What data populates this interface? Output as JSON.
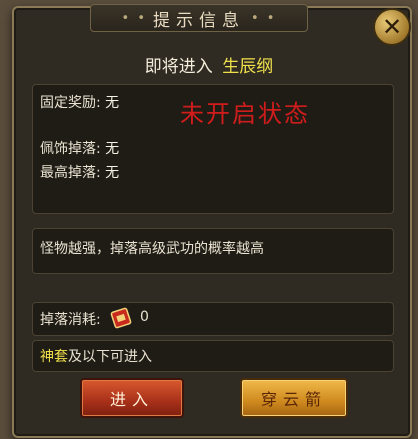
{
  "dialog": {
    "title": "提示信息",
    "close_icon": "close-x-icon"
  },
  "heading": {
    "prefix": "即将进入",
    "place": "生辰纲"
  },
  "info": {
    "fixed_reward_label": "固定奖励:",
    "fixed_reward_value": "无",
    "accessory_drop_label": "佩饰掉落:",
    "accessory_drop_value": "无",
    "top_drop_label": "最高掉落:",
    "top_drop_value": "无",
    "status": "未开启状态"
  },
  "description": "怪物越强，掉落高级武功的概率越高",
  "cost": {
    "label": "掉落消耗:",
    "icon": "scroll-icon",
    "value": "0"
  },
  "requirement": {
    "highlight": "神套",
    "rest": "及以下可进入"
  },
  "buttons": {
    "enter": "进入",
    "travel": "穿云箭"
  },
  "colors": {
    "highlight_yellow": "#f0e04c",
    "status_red": "#d11c1c",
    "enter_red": "#b2381f",
    "travel_gold": "#d9952a"
  }
}
